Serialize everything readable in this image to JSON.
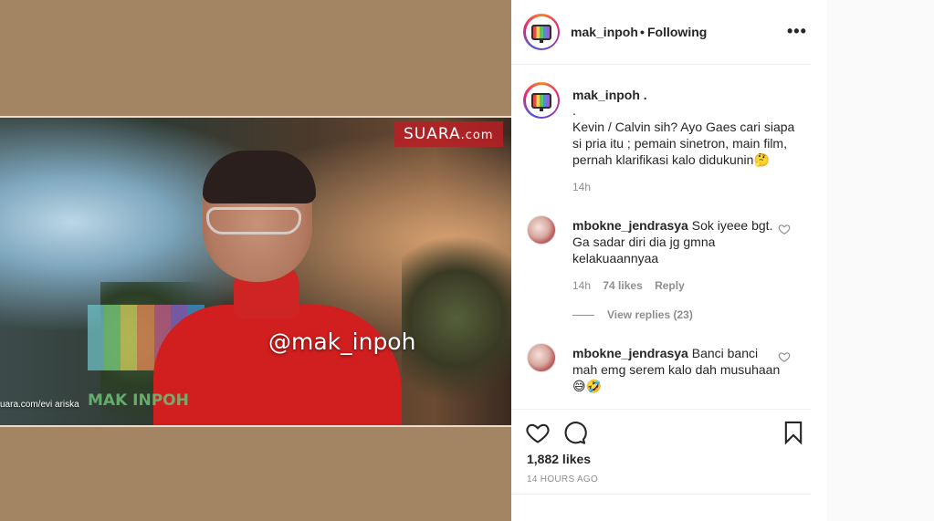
{
  "media": {
    "watermark_brand": "SUARA",
    "watermark_domain": ".com",
    "watermark_handle": "@mak_inpoh",
    "watermark_source": "uara.com/evi ariska",
    "watermark_logo": "MAK INPOH"
  },
  "header": {
    "username": "mak_inpoh",
    "separator": "•",
    "follow_status": "Following",
    "more_icon": "more-options-icon"
  },
  "caption": {
    "username": "mak_inpoh .",
    "dot_line": ".",
    "text": "Kevin / Calvin sih? Ayo Gaes cari siapa si pria itu ; pemain sinetron, main film, pernah klarifikasi kalo didukunin🤔",
    "time": "14h"
  },
  "comments": [
    {
      "username": "mbokne_jendrasya",
      "text": "Sok iyeee bgt. Ga sadar diri dia jg gmna kelakuaannyaa",
      "time": "14h",
      "likes": "74 likes",
      "reply_label": "Reply",
      "view_replies": "View replies (23)"
    },
    {
      "username": "mbokne_jendrasya",
      "text": "Banci banci mah emg serem kalo dah musuhaan 😅🤣"
    }
  ],
  "actions": {
    "like_icon": "heart-icon",
    "comment_icon": "comment-icon",
    "save_icon": "bookmark-icon",
    "likes": "1,882 likes",
    "posted": "14 HOURS AGO"
  },
  "colors": {
    "text": "#262626",
    "muted": "#8e8e8e",
    "media_bg": "#a48563",
    "border": "#efefef"
  }
}
